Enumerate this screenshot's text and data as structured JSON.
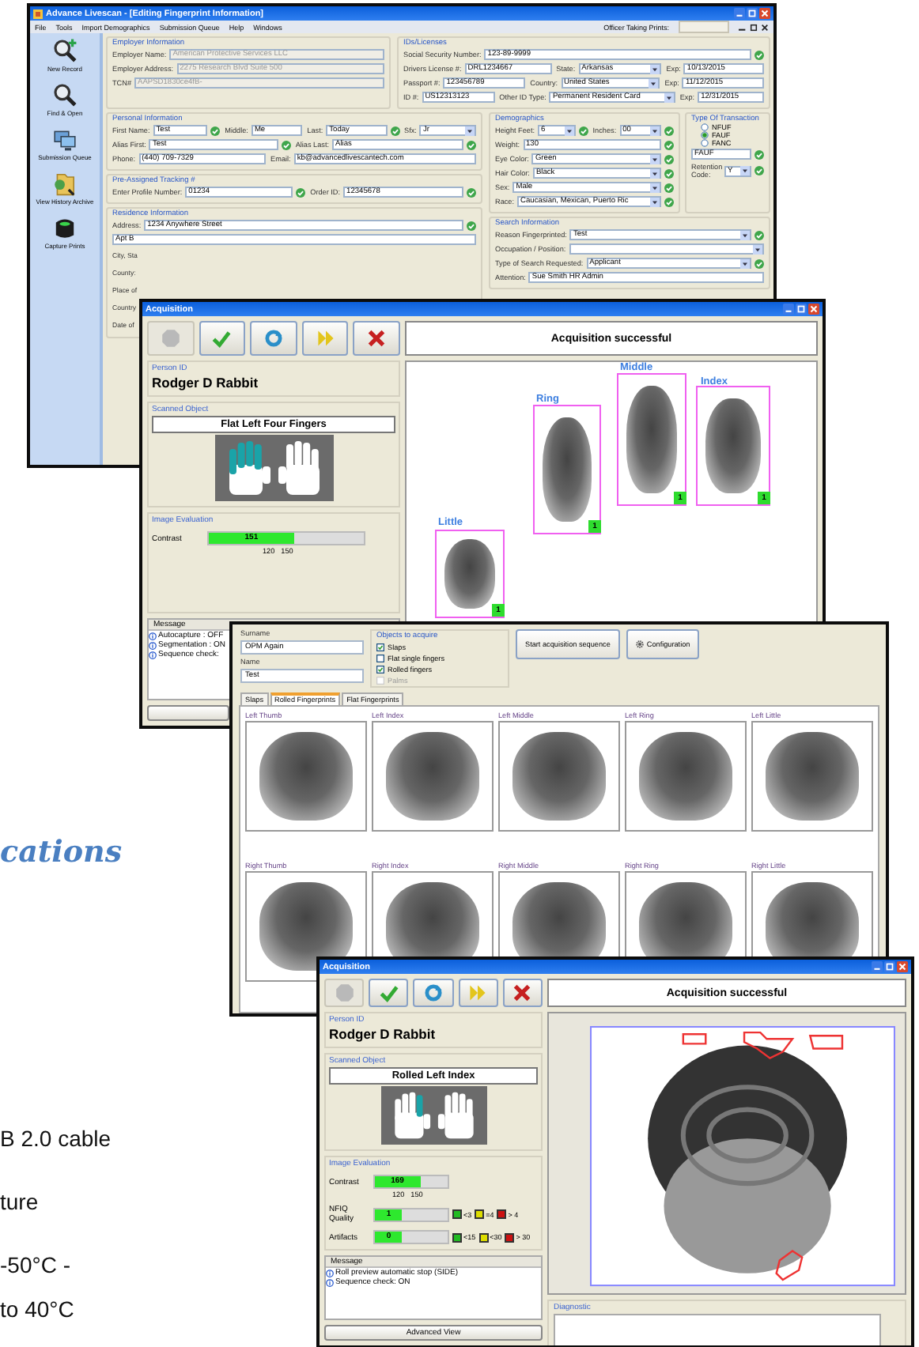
{
  "brochure": {
    "heading": "cations",
    "lines": [
      "B 2.0 cable",
      "ture",
      "-50°C -",
      "to 40°C"
    ]
  },
  "livescan": {
    "title": "Advance Livescan - [Editing Fingerprint Information]",
    "menu": [
      "File",
      "Tools",
      "Import Demographics",
      "Submission Queue",
      "Help",
      "Windows"
    ],
    "officer_label": "Officer Taking Prints:",
    "sidebar": [
      {
        "label": "New Record",
        "kind": "new"
      },
      {
        "label": "Find & Open",
        "kind": "find"
      },
      {
        "label": "Submission Queue",
        "kind": "queue"
      },
      {
        "label": "View History Archive",
        "kind": "archive"
      },
      {
        "label": "Capture Prints",
        "kind": "capture"
      }
    ],
    "employer": {
      "title": "Employer Information",
      "rows": [
        [
          {
            "label": "Employer Name:",
            "value": "American Protective Services LLC",
            "kind": "text",
            "valid": false,
            "disabled": true
          }
        ],
        [
          {
            "label": "Employer Address:",
            "value": "2275 Research Blvd Suite 500",
            "kind": "text",
            "valid": false,
            "disabled": true
          }
        ],
        [
          {
            "label": "TCN#",
            "value": "AAPSD1830ce4fB-",
            "kind": "text",
            "valid": false,
            "disabled": true
          }
        ]
      ]
    },
    "ids": {
      "title": "IDs/Licenses",
      "rows": [
        [
          {
            "label": "Social Security Number:",
            "value": "123-89-9999",
            "kind": "text",
            "valid": true,
            "disabled": false
          }
        ],
        [
          {
            "label": "Drivers License #:",
            "value": "DRL1234667",
            "kind": "text",
            "valid": false,
            "disabled": false
          },
          {
            "label": "State:",
            "value": "Arkansas",
            "kind": "select",
            "valid": false,
            "disabled": false
          },
          {
            "label": "Exp:",
            "value": "10/13/2015",
            "kind": "text",
            "valid": false,
            "disabled": false
          }
        ],
        [
          {
            "label": "Passport #:",
            "value": "123456789",
            "kind": "text",
            "valid": false,
            "disabled": false
          },
          {
            "label": "Country:",
            "value": "United States",
            "kind": "select",
            "valid": false,
            "disabled": false
          },
          {
            "label": "Exp:",
            "value": "11/12/2015",
            "kind": "text",
            "valid": false,
            "disabled": false
          }
        ],
        [
          {
            "label": "ID #:",
            "value": "US12313123",
            "kind": "text",
            "valid": false,
            "disabled": false
          },
          {
            "label": "Other ID Type:",
            "value": "Permanent Resident Card",
            "kind": "select",
            "valid": false,
            "disabled": false
          },
          {
            "label": "Exp:",
            "value": "12/31/2015",
            "kind": "text",
            "valid": false,
            "disabled": false
          }
        ]
      ]
    },
    "personal": {
      "title": "Personal Information",
      "rows": [
        [
          {
            "label": "First Name:",
            "value": "Test",
            "kind": "text",
            "valid": true,
            "disabled": false
          },
          {
            "label": "Middle:",
            "value": "Me",
            "kind": "text",
            "valid": false,
            "disabled": false
          },
          {
            "label": "Last:",
            "value": "Today",
            "kind": "text",
            "valid": true,
            "disabled": false
          },
          {
            "label": "Sfx:",
            "value": "Jr",
            "kind": "select",
            "valid": false,
            "disabled": false
          }
        ],
        [
          {
            "label": "Alias First:",
            "value": "Test",
            "kind": "text",
            "valid": true,
            "disabled": false
          },
          {
            "label": "Alias Last:",
            "value": "Alias",
            "kind": "text",
            "valid": true,
            "disabled": false
          }
        ],
        [
          {
            "label": "Phone:",
            "value": "(440) 709-7329",
            "kind": "text",
            "valid": false,
            "disabled": false
          },
          {
            "label": "Email:",
            "value": "kb@advancedlivescantech.com",
            "kind": "text",
            "valid": false,
            "disabled": false
          }
        ]
      ]
    },
    "tracking": {
      "title": "Pre-Assigned Tracking #",
      "rows": [
        [
          {
            "label": "Enter Profile Number:",
            "value": "01234",
            "kind": "text",
            "valid": true,
            "disabled": false
          },
          {
            "label": "Order ID:",
            "value": "12345678",
            "kind": "text",
            "valid": true,
            "disabled": false
          }
        ]
      ]
    },
    "residence": {
      "title": "Residence Information",
      "rows": [
        [
          {
            "label": "Address:",
            "value": "1234 Anywhere Street",
            "kind": "text",
            "valid": true,
            "disabled": false
          }
        ],
        [
          {
            "value": "Apt B",
            "kind": "text",
            "valid": false,
            "disabled": false
          }
        ]
      ],
      "cut_labels": [
        "City, Sta",
        "County:",
        "Place of",
        "Country",
        "Date of"
      ]
    },
    "demographics": {
      "title": "Demographics",
      "rows": [
        [
          {
            "label": "Height Feet:",
            "value": "6",
            "kind": "select",
            "valid": true,
            "disabled": false
          },
          {
            "label": "Inches:",
            "value": "00",
            "kind": "select",
            "valid": true,
            "disabled": false
          }
        ],
        [
          {
            "label": "Weight:",
            "value": "130",
            "kind": "text",
            "valid": true,
            "disabled": false
          }
        ],
        [
          {
            "label": "Eye Color:",
            "value": "Green",
            "kind": "select",
            "valid": true,
            "disabled": false
          }
        ],
        [
          {
            "label": "Hair Color:",
            "value": "Black",
            "kind": "select",
            "valid": true,
            "disabled": false
          }
        ],
        [
          {
            "label": "Sex:",
            "value": "Male",
            "kind": "select",
            "valid": true,
            "disabled": false
          }
        ],
        [
          {
            "label": "Race:",
            "value": "Caucasian, Mexican, Puerto Ric",
            "kind": "select",
            "valid": true,
            "disabled": false
          }
        ]
      ]
    },
    "transaction": {
      "title": "Type Of Transaction",
      "options": [
        {
          "label": "NFUF",
          "selected": false
        },
        {
          "label": "FAUF",
          "selected": true
        },
        {
          "label": "FANC",
          "selected": false
        }
      ],
      "field": {
        "value": "FAUF",
        "kind": "text",
        "valid": true,
        "disabled": false
      },
      "retention_label": "Retention Code:",
      "retention_field": {
        "value": "Y",
        "kind": "select",
        "valid": true,
        "disabled": false
      }
    },
    "search": {
      "title": "Search Information",
      "rows": [
        [
          {
            "label": "Reason Fingerprinted:",
            "value": "Test",
            "kind": "select",
            "valid": true,
            "disabled": false
          }
        ],
        [
          {
            "label": "Occupation / Position:",
            "kind": "select",
            "valid": false,
            "disabled": false
          }
        ],
        [
          {
            "label": "Type of Search Requested:",
            "value": "Applicant",
            "kind": "select",
            "valid": true,
            "disabled": false
          }
        ],
        [
          {
            "label": "Attention:",
            "value": "Sue Smith HR Admin",
            "kind": "text",
            "valid": false,
            "disabled": false
          }
        ]
      ]
    }
  },
  "acquisition_1": {
    "title": "Acquisition",
    "tools": [
      {
        "kind": "stop",
        "disabled": true
      },
      {
        "kind": "accept",
        "disabled": false
      },
      {
        "kind": "refresh",
        "disabled": false
      },
      {
        "kind": "next",
        "disabled": false
      },
      {
        "kind": "cancel",
        "disabled": false
      }
    ],
    "status": "Acquisition successful",
    "person_label": "Person ID",
    "person": "Rodger D Rabbit",
    "object_label": "Scanned Object",
    "object": "Flat Left Four Fingers",
    "hands": [
      {
        "fingers": [
          true,
          true,
          true,
          true,
          false
        ]
      },
      {
        "fingers": [
          false,
          false,
          false,
          false,
          false
        ]
      }
    ],
    "eval_label": "Image Evaluation",
    "metrics": [
      {
        "label": "Contrast",
        "value": "151",
        "level": 0.55,
        "ticks": [
          "120",
          "150"
        ]
      }
    ],
    "message_label": "Message",
    "messages": [
      "Autocapture : OFF",
      "Segmentation : ON",
      "Sequence check:"
    ],
    "prints": [
      {
        "label": "Little",
        "badge": "1"
      },
      {
        "label": "Ring",
        "badge": "1"
      },
      {
        "label": "Middle",
        "badge": "1"
      },
      {
        "label": "Index",
        "badge": "1"
      }
    ]
  },
  "sequence": {
    "surname_label": "Surname",
    "surname": "OPM Again",
    "name_label": "Name",
    "name": "Test",
    "objects_title": "Objects to acquire",
    "objects": [
      {
        "label": "Slaps",
        "checked": true,
        "disabled": false
      },
      {
        "label": "Flat single fingers",
        "checked": false,
        "disabled": false
      },
      {
        "label": "Rolled fingers",
        "checked": true,
        "disabled": false
      },
      {
        "label": "Palms",
        "checked": false,
        "disabled": true
      }
    ],
    "start_button": "Start acquisition sequence",
    "config_button": "Configuration",
    "tabs": [
      {
        "label": "Slaps",
        "selected": false
      },
      {
        "label": "Rolled Fingerprints",
        "selected": true
      },
      {
        "label": "Flat Fingerprints",
        "selected": false
      }
    ],
    "prints": [
      {
        "label": "Left Thumb"
      },
      {
        "label": "Left Index"
      },
      {
        "label": "Left Middle"
      },
      {
        "label": "Left Ring"
      },
      {
        "label": "Left Little"
      },
      {
        "label": "Right Thumb"
      },
      {
        "label": "Right Index"
      },
      {
        "label": "Right Middle"
      },
      {
        "label": "Right Ring"
      },
      {
        "label": "Right Little"
      }
    ]
  },
  "acquisition_2": {
    "title": "Acquisition",
    "tools": [
      {
        "kind": "stop",
        "disabled": true
      },
      {
        "kind": "accept",
        "disabled": false
      },
      {
        "kind": "refresh",
        "disabled": false
      },
      {
        "kind": "next",
        "disabled": false
      },
      {
        "kind": "cancel",
        "disabled": false
      }
    ],
    "status": "Acquisition successful",
    "person_label": "Person ID",
    "person": "Rodger D Rabbit",
    "object_label": "Scanned Object",
    "object": "Rolled Left Index",
    "hands": [
      {
        "fingers": [
          false,
          false,
          false,
          true,
          false
        ]
      },
      {
        "fingers": [
          false,
          false,
          false,
          false,
          false
        ]
      }
    ],
    "eval_label": "Image Evaluation",
    "metrics": [
      {
        "label": "Contrast",
        "value": "169",
        "level": 0.62,
        "ticks": [
          "120",
          "150"
        ]
      },
      {
        "label": "NFIQ Quality",
        "value": "1",
        "level": 0.38,
        "legend": [
          {
            "color": "#22bb22",
            "label": "<3"
          },
          {
            "color": "#dddd00",
            "label": "=4"
          },
          {
            "color": "#cc1111",
            "label": "> 4"
          }
        ]
      },
      {
        "label": "Artifacts",
        "value": "0",
        "level": 0.38,
        "legend": [
          {
            "color": "#22bb22",
            "label": "<15"
          },
          {
            "color": "#dddd00",
            "label": "<30"
          },
          {
            "color": "#cc1111",
            "label": "> 30"
          }
        ]
      }
    ],
    "message_label": "Message",
    "messages": [
      "Roll preview automatic stop (SIDE)",
      "Sequence check: ON"
    ],
    "advanced_button": "Advanced View",
    "diagnostic_label": "Diagnostic"
  }
}
